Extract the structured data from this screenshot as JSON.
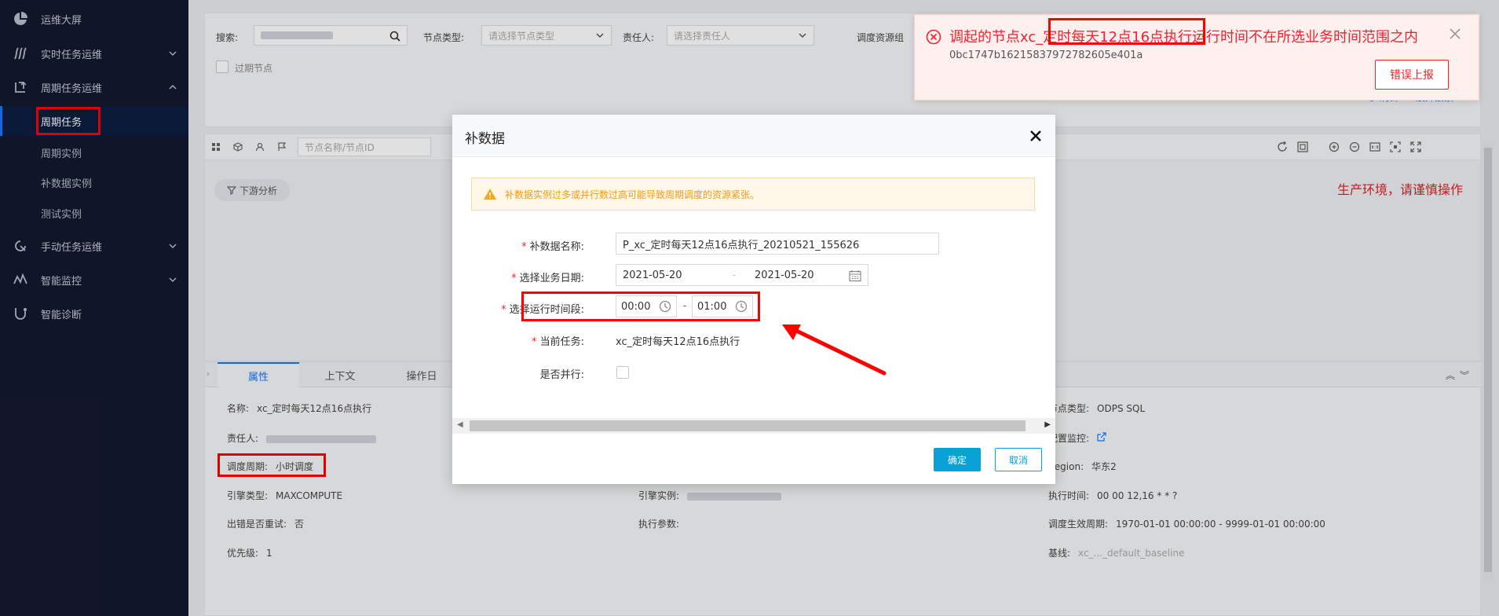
{
  "sidebar": {
    "items": [
      {
        "label": "运维大屏",
        "icon": "pie-chart-icon"
      },
      {
        "label": "实时任务运维",
        "icon": "realtime-icon"
      },
      {
        "label": "周期任务运维",
        "icon": "cycle-icon"
      },
      {
        "label": "手动任务运维",
        "icon": "manual-icon"
      },
      {
        "label": "智能监控",
        "icon": "monitor-icon"
      },
      {
        "label": "智能诊断",
        "icon": "diagnose-icon"
      }
    ],
    "sub_items": [
      "周期任务",
      "周期实例",
      "补数据实例",
      "测试实例"
    ]
  },
  "search": {
    "search_label": "搜索:",
    "node_type_label": "节点类型:",
    "node_type_placeholder": "请选择节点类型",
    "owner_label": "责任人:",
    "owner_placeholder": "请选择责任人",
    "resource_group_label": "调度资源组",
    "expired_label": "过期节点",
    "refresh": "刷新",
    "expand_search": "展开搜索"
  },
  "toolbar": {
    "filter_placeholder": "节点名称/节点ID"
  },
  "canvas": {
    "downstream_btn": "下游分析",
    "prod_warning": "生产环境，请谨慎操作"
  },
  "detail": {
    "tabs": [
      "属性",
      "上下文",
      "操作日"
    ],
    "left": [
      {
        "k": "名称:",
        "v": "xc_定时每天12点16点执行"
      },
      {
        "k": "责任人:",
        "v": ""
      },
      {
        "k": "调度周期:",
        "v": "小时调度"
      },
      {
        "k": "引擎类型:",
        "v": "MAXCOMPUTE"
      },
      {
        "k": "出错是否重试:",
        "v": "否"
      },
      {
        "k": "优先级:",
        "v": "1"
      }
    ],
    "mid": [
      {
        "k": "引擎实例:",
        "v": ""
      },
      {
        "k": "执行参数:",
        "v": ""
      }
    ],
    "right": [
      {
        "k": "节点类型:",
        "v": "ODPS SQL"
      },
      {
        "k": "配置监控:",
        "v": ""
      },
      {
        "k": "Region:",
        "v": "华东2"
      },
      {
        "k": "执行时间:",
        "v": "00 00 12,16 * * ?"
      },
      {
        "k": "调度生效周期:",
        "v": "1970-01-01 00:00:00 - 9999-01-01 00:00:00"
      },
      {
        "k": "基线:",
        "v": "xc_..._default_baseline"
      }
    ]
  },
  "modal": {
    "title": "补数据",
    "warning": "补数据实例过多或并行数过高可能导致周期调度的资源紧张。",
    "name_label": "补数据名称:",
    "name_value": "P_xc_定时每天12点16点执行_20210521_155626",
    "date_label": "选择业务日期:",
    "date_start": "2021-05-20",
    "date_end": "2021-05-20",
    "date_sep": "-",
    "time_label": "选择运行时间段:",
    "time_start": "00:00",
    "time_end": "01:00",
    "time_sep": "-",
    "current_task_label": "当前任务:",
    "current_task_value": "xc_定时每天12点16点执行",
    "parallel_label": "是否并行:",
    "confirm": "确定",
    "cancel": "取消"
  },
  "error_toast": {
    "message": "调起的节点xc_定时每天12点16点执行运行时间不在所选业务时间范围之内",
    "request_id": "0bc1747b16215837972782605e401a",
    "report_button": "错误上报"
  },
  "colors": {
    "sidebar_bg": "#14192e",
    "accent": "#1677ff",
    "primary_btn": "#0aa0d8",
    "error": "#f5222d",
    "annotation": "#ff0000"
  }
}
